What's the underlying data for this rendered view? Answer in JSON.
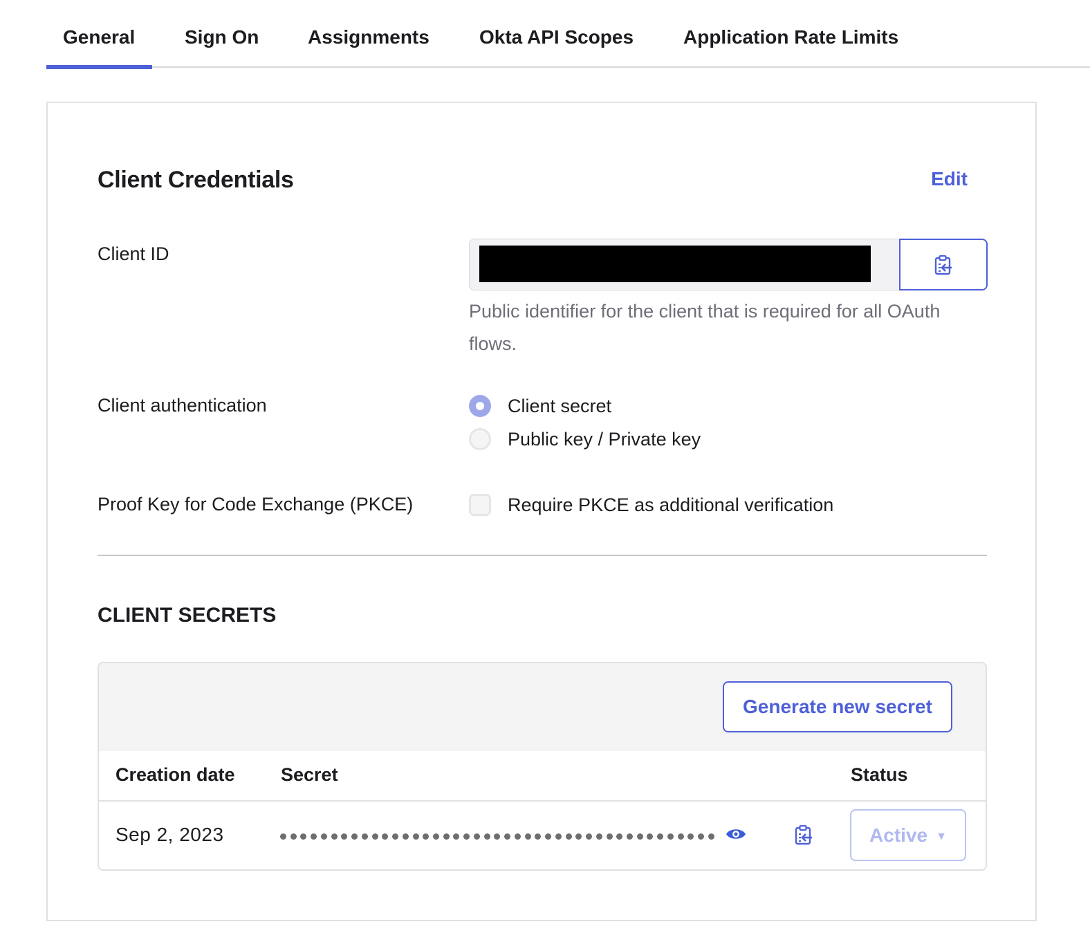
{
  "tabs": [
    {
      "label": "General",
      "active": true
    },
    {
      "label": "Sign On",
      "active": false
    },
    {
      "label": "Assignments",
      "active": false
    },
    {
      "label": "Okta API Scopes",
      "active": false
    },
    {
      "label": "Application Rate Limits",
      "active": false
    }
  ],
  "credentials": {
    "title": "Client Credentials",
    "edit_label": "Edit",
    "client_id": {
      "label": "Client ID",
      "value_redacted": true,
      "copy_icon": "clipboard-copy-icon",
      "help_text": "Public identifier for the client that is required for all OAuth flows."
    },
    "client_auth": {
      "label": "Client authentication",
      "options": [
        {
          "label": "Client secret",
          "selected": true
        },
        {
          "label": "Public key / Private key",
          "selected": false
        }
      ]
    },
    "pkce": {
      "label": "Proof Key for Code Exchange (PKCE)",
      "checkbox_label": "Require PKCE as additional verification",
      "checked": false
    }
  },
  "secrets": {
    "title": "CLIENT SECRETS",
    "generate_label": "Generate new secret",
    "columns": [
      "Creation date",
      "Secret",
      "Status"
    ],
    "rows": [
      {
        "creation_date": "Sep 2, 2023",
        "secret_masked_length": 43,
        "reveal_icon": "eye-icon",
        "copy_icon": "clipboard-copy-icon",
        "status": "Active"
      }
    ]
  },
  "colors": {
    "accent": "#4e60d8",
    "text": "#1d1d21",
    "muted_text": "#6e6e78",
    "radio_checked": "#9da8ea",
    "status_disabled": "#b0b8ef"
  }
}
